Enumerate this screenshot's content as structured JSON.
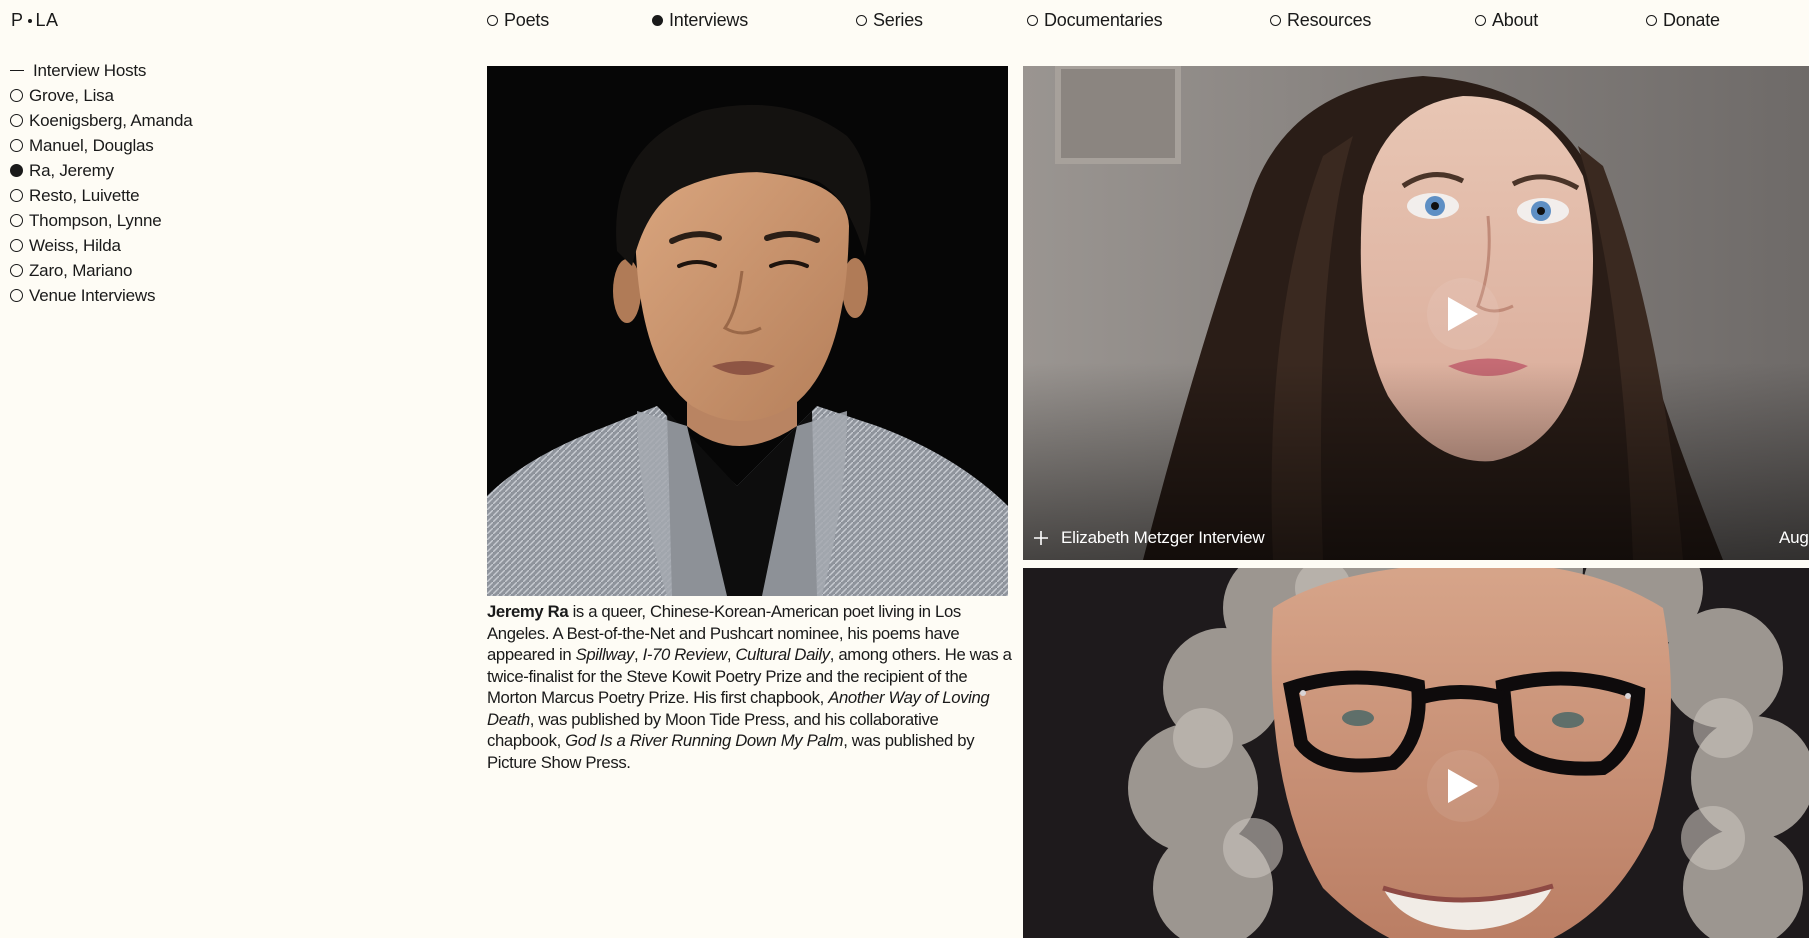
{
  "site": {
    "logo_left": "P",
    "logo_right": "LA"
  },
  "nav": {
    "items": [
      {
        "label": "Poets",
        "selected": false
      },
      {
        "label": "Interviews",
        "selected": true
      },
      {
        "label": "Series",
        "selected": false
      },
      {
        "label": "Documentaries",
        "selected": false
      },
      {
        "label": "Resources",
        "selected": false
      },
      {
        "label": "About",
        "selected": false
      },
      {
        "label": "Donate",
        "selected": false
      }
    ]
  },
  "sidebar": {
    "heading": "Interview Hosts",
    "items": [
      {
        "label": "Grove, Lisa",
        "selected": false
      },
      {
        "label": "Koenigsberg, Amanda",
        "selected": false
      },
      {
        "label": "Manuel, Douglas",
        "selected": false
      },
      {
        "label": "Ra, Jeremy",
        "selected": true
      },
      {
        "label": "Resto, Luivette",
        "selected": false
      },
      {
        "label": "Thompson, Lynne",
        "selected": false
      },
      {
        "label": "Weiss, Hilda",
        "selected": false
      },
      {
        "label": "Zaro, Mariano",
        "selected": false
      },
      {
        "label": "Venue Interviews",
        "selected": false
      }
    ]
  },
  "feature": {
    "name": "Jeremy Ra",
    "bio": [
      {
        "t": " is a queer, Chinese-Korean-American poet living in Los Angeles. A Best-of-the-Net and Pushcart nominee, his poems have appeared in "
      },
      {
        "t": "Spillway",
        "i": true
      },
      {
        "t": ", "
      },
      {
        "t": "I-70 Review",
        "i": true
      },
      {
        "t": ", "
      },
      {
        "t": "Cultural Daily",
        "i": true
      },
      {
        "t": ", among others. He was a twice-finalist for the Steve Kowit Poetry Prize and the recipient of the Morton Marcus Poetry Prize. His first chapbook, "
      },
      {
        "t": "Another Way of Loving Death",
        "i": true
      },
      {
        "t": ", was published by Moon Tide Press, and his collaborative chapbook, "
      },
      {
        "t": "God Is a River Running Down My Palm",
        "i": true
      },
      {
        "t": ", was published by Picture Show Press."
      }
    ]
  },
  "videos": [
    {
      "title": "Elizabeth Metzger Interview",
      "date": "Aug"
    }
  ],
  "colors": {
    "background": "#fefcf5",
    "text": "#1a1a1a"
  }
}
